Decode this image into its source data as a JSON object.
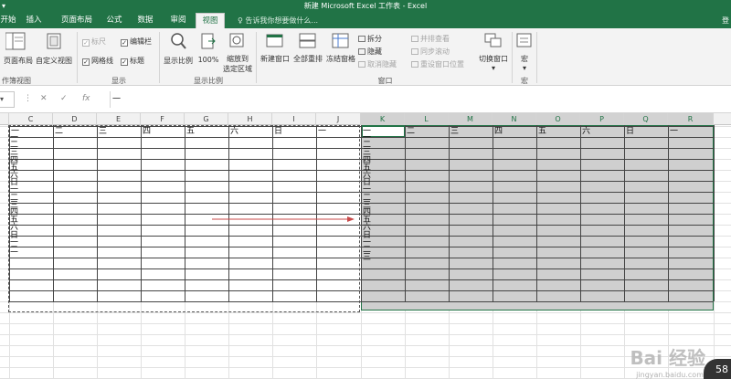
{
  "app": {
    "title": "新建 Microsoft Excel 工作表 - Excel",
    "quick_access": "▾"
  },
  "tabs": [
    {
      "label": "开始",
      "active": false
    },
    {
      "label": "插入",
      "active": false
    },
    {
      "label": "页面布局",
      "active": false
    },
    {
      "label": "公式",
      "active": false
    },
    {
      "label": "数据",
      "active": false
    },
    {
      "label": "审阅",
      "active": false
    },
    {
      "label": "视图",
      "active": true
    }
  ],
  "tell_me": "♀ 告诉我你想要做什么...",
  "login": "登",
  "ribbon": {
    "workbook_views": {
      "page_layout": "页面布局",
      "custom_views": "自定义视图",
      "group_label": "作簿视图"
    },
    "show": {
      "ruler": "标尺",
      "formula_bar": "编辑栏",
      "gridlines": "网格线",
      "headings": "标题",
      "group_label": "显示"
    },
    "zoom": {
      "zoom": "显示比例",
      "zoom_100": "100%",
      "zoom_selection_line1": "缩放到",
      "zoom_selection_line2": "选定区域",
      "group_label": "显示比例"
    },
    "window": {
      "new_window": "新建窗口",
      "arrange_all": "全部重排",
      "freeze_panes": "冻结窗格",
      "split": "拆分",
      "hide": "隐藏",
      "unhide": "取消隐藏",
      "side_by_side": "并排查看",
      "sync_scroll": "同步滚动",
      "reset_position": "重设窗口位置",
      "switch_windows": "切换窗口",
      "group_label": "窗口"
    },
    "macros": {
      "macros": "宏",
      "group_label": "宏"
    }
  },
  "formula_bar": {
    "cancel": "✕",
    "enter": "✓",
    "fx": "fx",
    "value": "一"
  },
  "columns": [
    "C",
    "D",
    "E",
    "F",
    "G",
    "H",
    "I",
    "J",
    "K",
    "L",
    "M",
    "N",
    "O",
    "P",
    "Q",
    "R"
  ],
  "left_header_row": [
    "一",
    "二",
    "三",
    "四",
    "五",
    "六",
    "日",
    "一"
  ],
  "left_col_values": [
    "一",
    "二",
    "三",
    "四",
    "五",
    "六",
    "日",
    "一",
    "二",
    "三",
    "四",
    "五",
    "六",
    "日",
    "一",
    "二"
  ],
  "right_header_row": [
    "一",
    "二",
    "三",
    "四",
    "五",
    "六",
    "日",
    "一"
  ],
  "right_col_values": [
    "一",
    "二",
    "三",
    "四",
    "五",
    "六",
    "日",
    "一",
    "二",
    "三",
    "四",
    "五",
    "六",
    "日",
    "一",
    "二",
    "三"
  ],
  "watermark": {
    "text": "Bai 经验",
    "sub": "jingyan.baidu.com",
    "badge": "58"
  },
  "colors": {
    "accent": "#217346",
    "selection_fill": "#cfcfcf"
  }
}
